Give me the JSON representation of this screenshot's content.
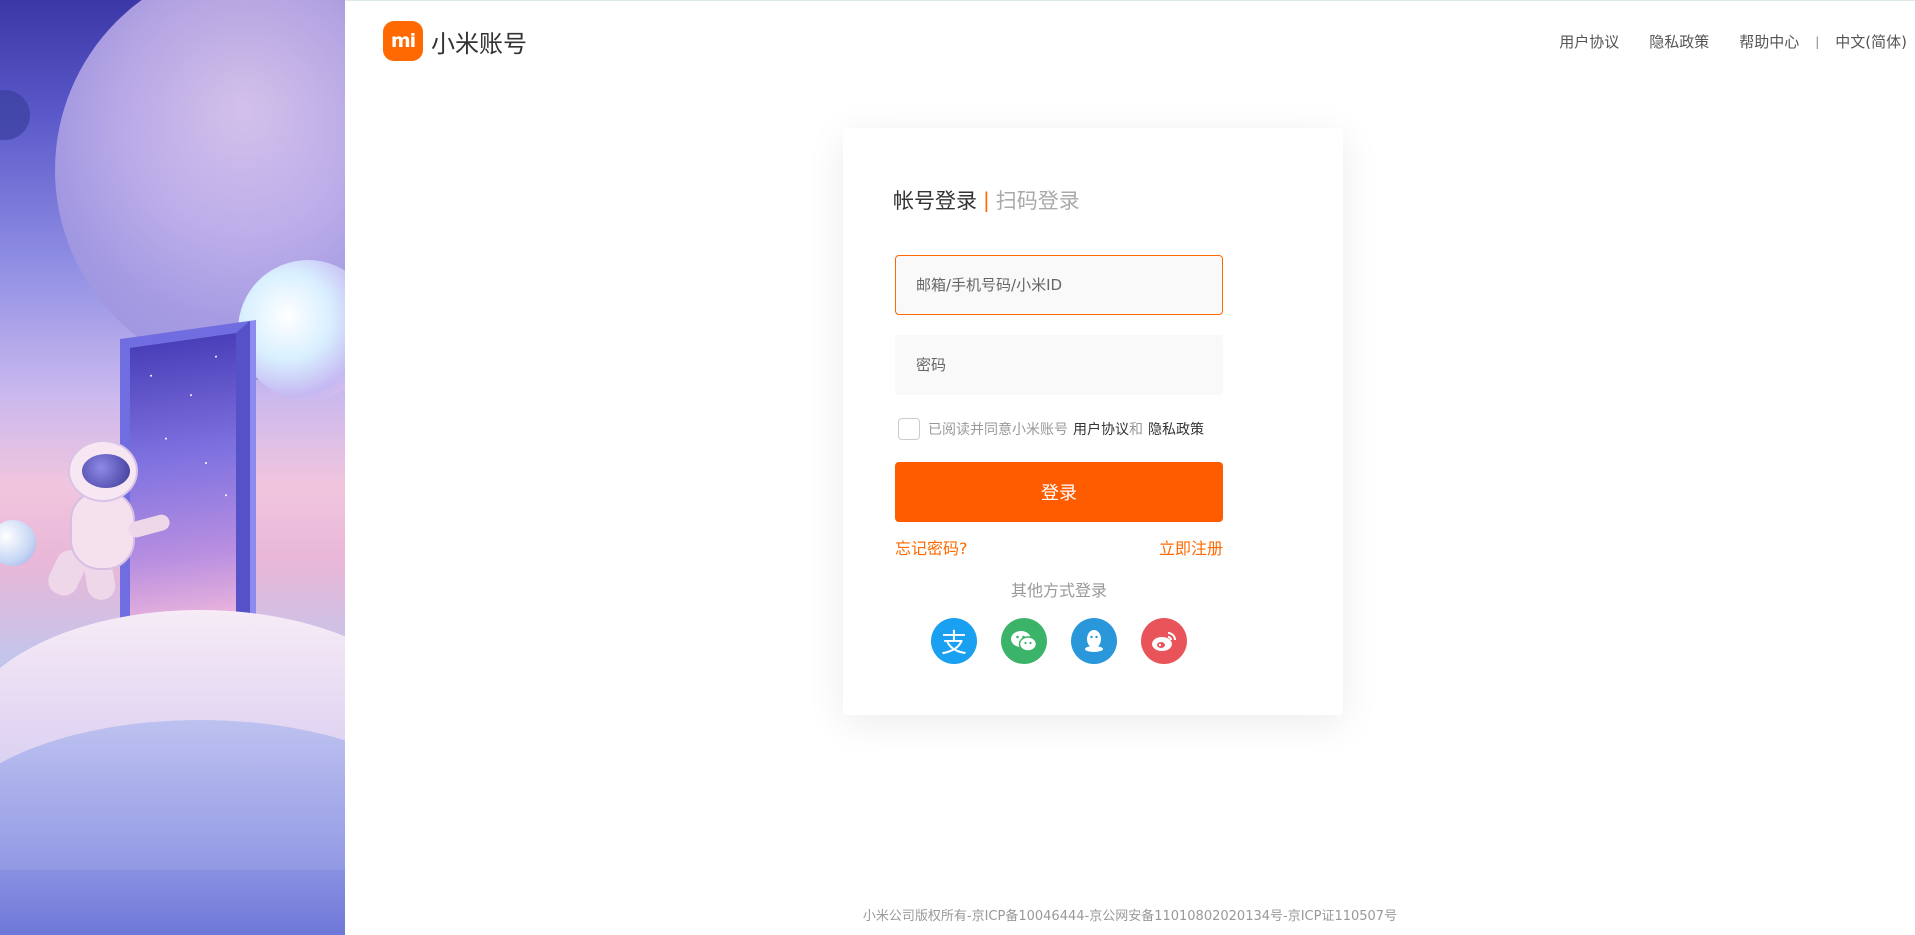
{
  "header": {
    "logo_mark": "mi",
    "logo_text": "小米账号",
    "nav": [
      "用户协议",
      "隐私政策",
      "帮助中心"
    ],
    "separator": "|",
    "language": "中文(简体)"
  },
  "login": {
    "tab_account": "帐号登录",
    "tab_separator": "|",
    "tab_qr": "扫码登录",
    "account_placeholder": "邮箱/手机号码/小米ID",
    "password_placeholder": "密码",
    "agree_text": "已阅读并同意小米账号",
    "agree_user": "用户协议",
    "agree_and": "和",
    "agree_privacy": "隐私政策",
    "submit_label": "登录",
    "forgot_label": "忘记密码?",
    "register_label": "立即注册",
    "other_title": "其他方式登录"
  },
  "socials": [
    {
      "name": "alipay-icon",
      "glyph": "支",
      "color": "#1aa0f0"
    },
    {
      "name": "wechat-icon",
      "glyph": "",
      "color": "#3bb469"
    },
    {
      "name": "qq-icon",
      "glyph": "",
      "color": "#2a97da"
    },
    {
      "name": "weibo-icon",
      "glyph": "",
      "color": "#e9545b"
    }
  ],
  "footer": {
    "text": "小米公司版权所有-京ICP备10046444-京公网安备11010802020134号-京ICP证110507号"
  },
  "colors": {
    "brand": "#ff6900",
    "button": "#ff5c00"
  }
}
